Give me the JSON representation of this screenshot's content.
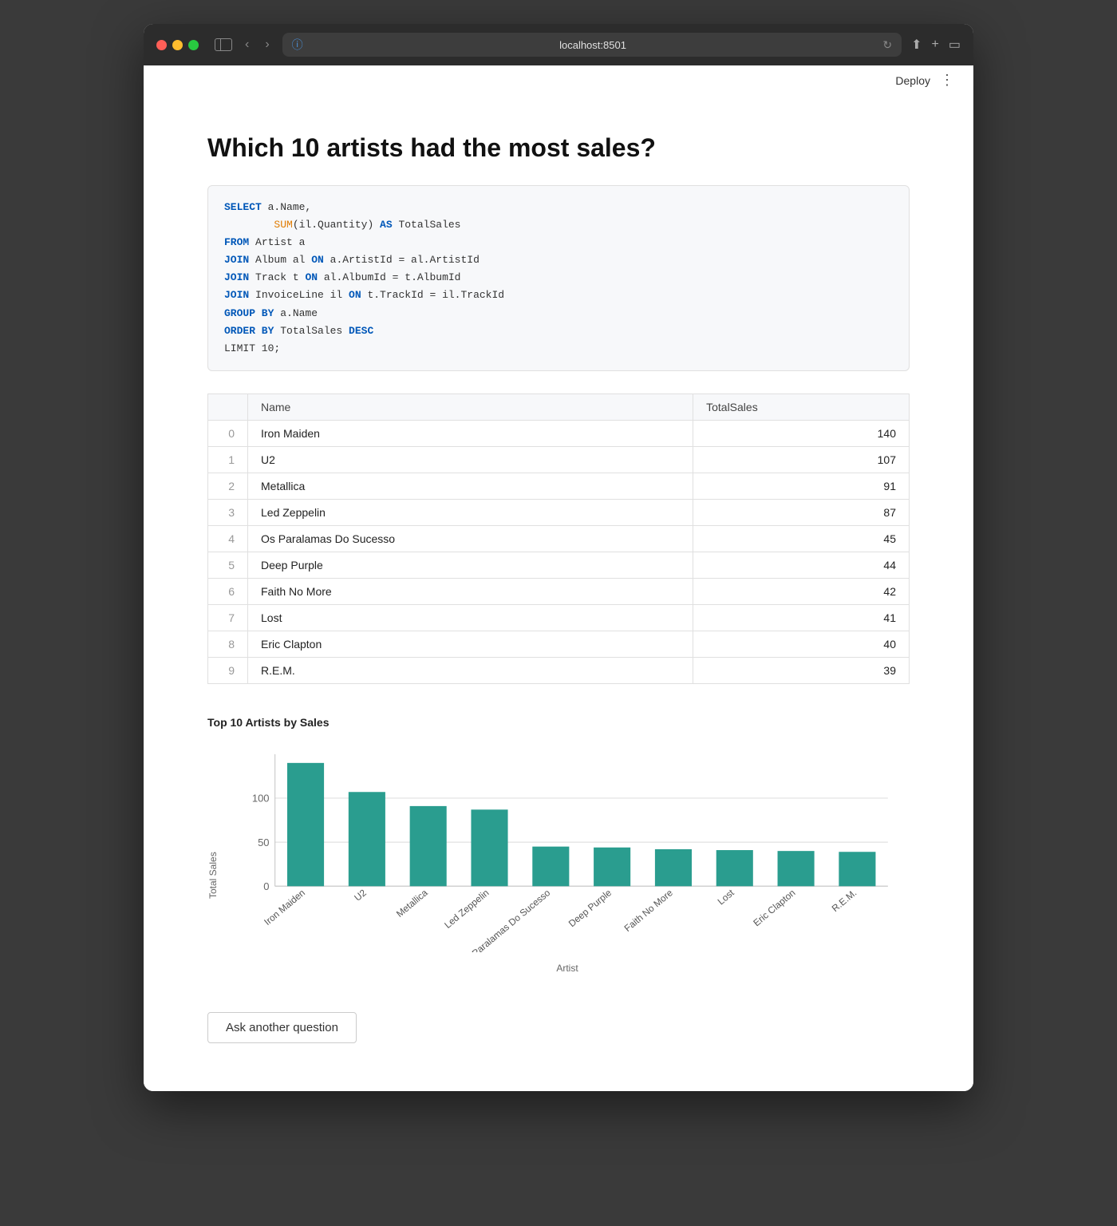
{
  "browser": {
    "url": "localhost:8501",
    "deploy_label": "Deploy",
    "more_label": "⋮"
  },
  "page": {
    "title": "Which 10 artists had the most sales?",
    "ask_button": "Ask another question"
  },
  "sql": {
    "lines": [
      {
        "parts": [
          {
            "type": "kw",
            "text": "SELECT"
          },
          {
            "type": "plain",
            "text": " a.Name,"
          }
        ]
      },
      {
        "parts": [
          {
            "type": "plain",
            "text": "        "
          },
          {
            "type": "fn",
            "text": "SUM"
          },
          {
            "type": "plain",
            "text": "(il.Quantity) "
          },
          {
            "type": "kw",
            "text": "AS"
          },
          {
            "type": "plain",
            "text": " TotalSales"
          }
        ]
      },
      {
        "parts": [
          {
            "type": "kw",
            "text": "FROM"
          },
          {
            "type": "plain",
            "text": " Artist a"
          }
        ]
      },
      {
        "parts": [
          {
            "type": "kw",
            "text": "JOIN"
          },
          {
            "type": "plain",
            "text": " Album al "
          },
          {
            "type": "kw",
            "text": "ON"
          },
          {
            "type": "plain",
            "text": " a.ArtistId = al.ArtistId"
          }
        ]
      },
      {
        "parts": [
          {
            "type": "kw",
            "text": "JOIN"
          },
          {
            "type": "plain",
            "text": " Track t "
          },
          {
            "type": "kw",
            "text": "ON"
          },
          {
            "type": "plain",
            "text": " al.AlbumId = t.AlbumId"
          }
        ]
      },
      {
        "parts": [
          {
            "type": "kw",
            "text": "JOIN"
          },
          {
            "type": "plain",
            "text": " InvoiceLine il "
          },
          {
            "type": "kw",
            "text": "ON"
          },
          {
            "type": "plain",
            "text": " t.TrackId = il.TrackId"
          }
        ]
      },
      {
        "parts": [
          {
            "type": "kw",
            "text": "GROUP BY"
          },
          {
            "type": "plain",
            "text": " a.Name"
          }
        ]
      },
      {
        "parts": [
          {
            "type": "kw",
            "text": "ORDER BY"
          },
          {
            "type": "plain",
            "text": " TotalSales "
          },
          {
            "type": "kw",
            "text": "DESC"
          }
        ]
      },
      {
        "parts": [
          {
            "type": "plain",
            "text": "LIMIT 10;"
          }
        ]
      }
    ]
  },
  "table": {
    "headers": [
      "",
      "Name",
      "TotalSales"
    ],
    "rows": [
      {
        "index": 0,
        "name": "Iron Maiden",
        "sales": 140
      },
      {
        "index": 1,
        "name": "U2",
        "sales": 107
      },
      {
        "index": 2,
        "name": "Metallica",
        "sales": 91
      },
      {
        "index": 3,
        "name": "Led Zeppelin",
        "sales": 87
      },
      {
        "index": 4,
        "name": "Os Paralamas Do Sucesso",
        "sales": 45
      },
      {
        "index": 5,
        "name": "Deep Purple",
        "sales": 44
      },
      {
        "index": 6,
        "name": "Faith No More",
        "sales": 42
      },
      {
        "index": 7,
        "name": "Lost",
        "sales": 41
      },
      {
        "index": 8,
        "name": "Eric Clapton",
        "sales": 40
      },
      {
        "index": 9,
        "name": "R.E.M.",
        "sales": 39
      }
    ]
  },
  "chart": {
    "title": "Top 10 Artists by Sales",
    "y_label": "Total Sales",
    "x_label": "Artist",
    "color": "#2a9d8f",
    "max_value": 150,
    "y_ticks": [
      0,
      50,
      100
    ],
    "bars": [
      {
        "label": "Iron Maiden",
        "value": 140
      },
      {
        "label": "U2",
        "value": 107
      },
      {
        "label": "Metallica",
        "value": 91
      },
      {
        "label": "Led Zeppelin",
        "value": 87
      },
      {
        "label": "Os Paralamas Do Sucesso",
        "value": 45
      },
      {
        "label": "Deep Purple",
        "value": 44
      },
      {
        "label": "Faith No More",
        "value": 42
      },
      {
        "label": "Lost",
        "value": 41
      },
      {
        "label": "Eric Clapton",
        "value": 40
      },
      {
        "label": "R.E.M.",
        "value": 39
      }
    ]
  }
}
